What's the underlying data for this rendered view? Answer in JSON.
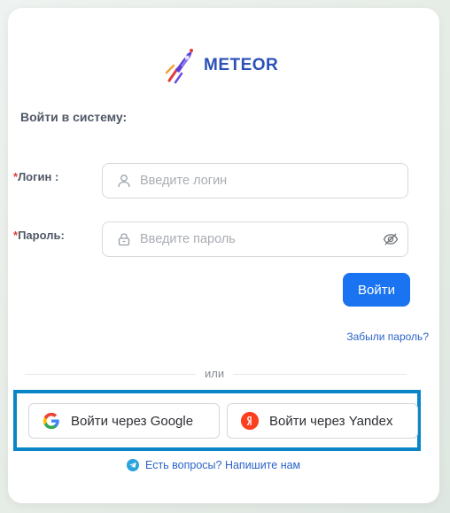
{
  "brand": {
    "name": "METEOR"
  },
  "form": {
    "heading": "Войти в систему:",
    "login": {
      "required_mark": "*",
      "label": "Логин",
      "colon": ":",
      "placeholder": "Введите логин"
    },
    "password": {
      "required_mark": "*",
      "label": "Пароль",
      "colon": ":",
      "placeholder": "Введите пароль"
    },
    "submit_label": "Войти",
    "forgot_label": "Забыли пароль?"
  },
  "divider": {
    "text": "или"
  },
  "oauth": {
    "google_label": "Войти через Google",
    "yandex_label": "Войти через Yandex"
  },
  "help": {
    "text": "Есть вопросы? Напишите нам"
  },
  "colors": {
    "accent": "#1a73f0",
    "brand_text": "#2b50b8",
    "highlight_border": "#0a86c7",
    "required": "#e0403a"
  },
  "icons": [
    "meteor-logo-icon",
    "user-icon",
    "lock-icon",
    "eye-off-icon",
    "google-icon",
    "yandex-icon",
    "telegram-icon"
  ]
}
